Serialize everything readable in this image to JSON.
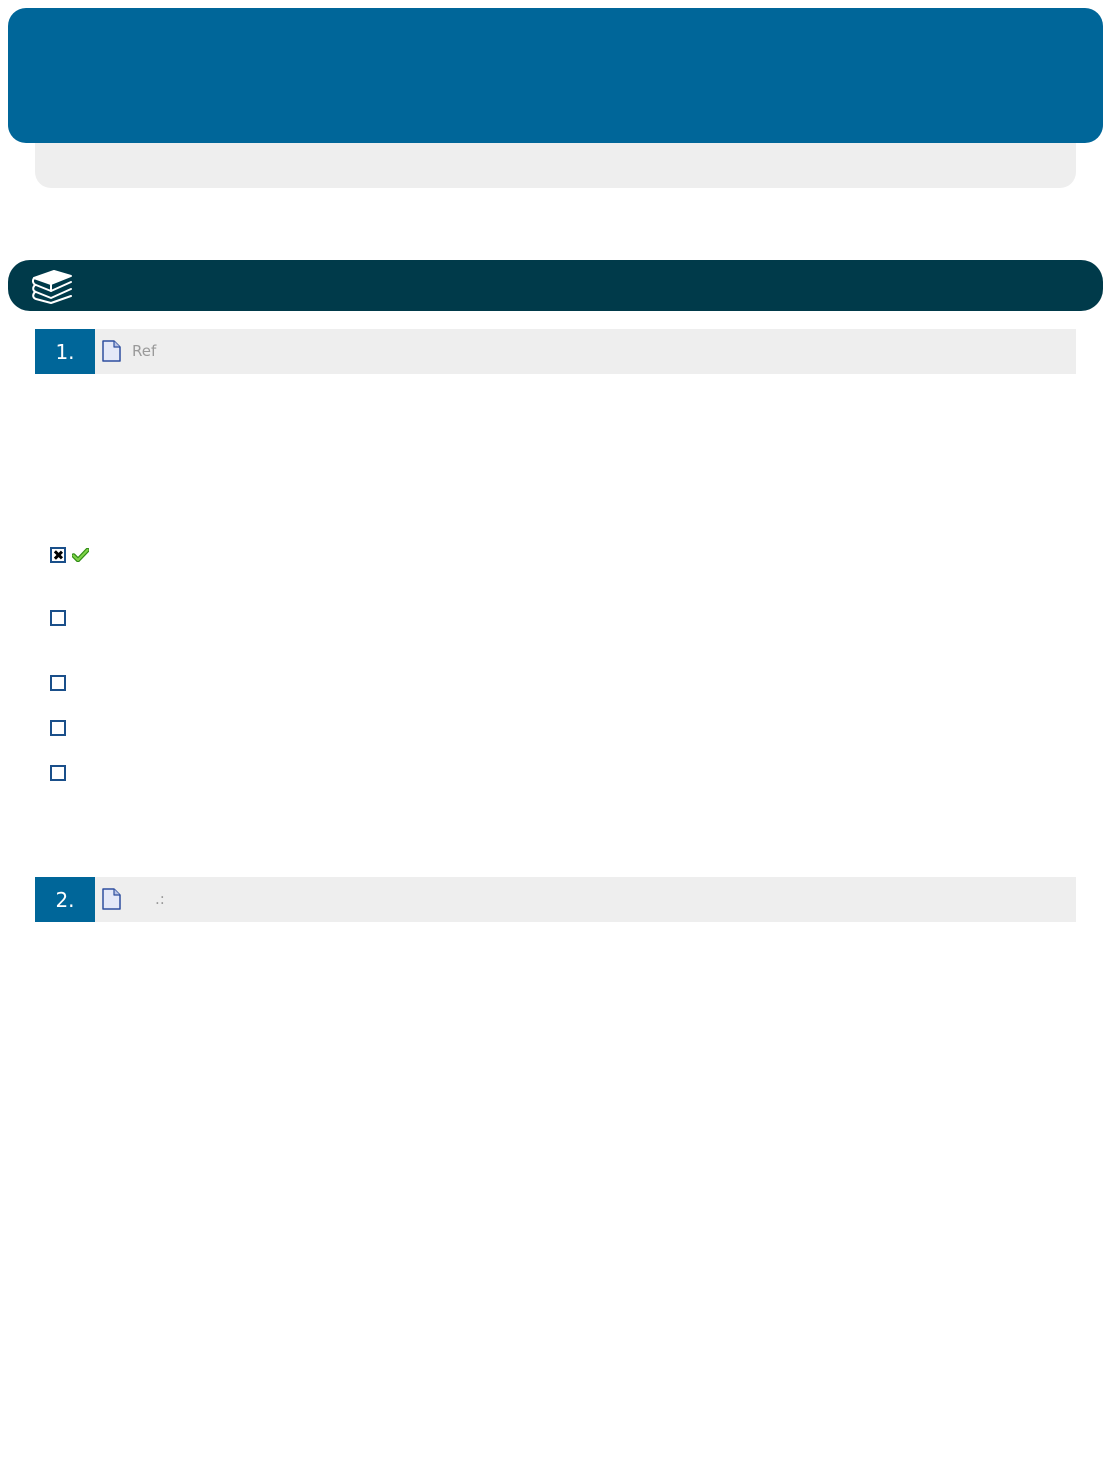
{
  "header": {
    "title": "",
    "subtitle": ""
  },
  "section": {
    "title": "",
    "icon": "books-stack-icon"
  },
  "questions": [
    {
      "number": "1.",
      "text": "Ref",
      "icon": "document-icon",
      "options": [
        {
          "label": "",
          "checked": true,
          "correct": true
        },
        {
          "label": "",
          "checked": false
        },
        {
          "label": "",
          "checked": false
        },
        {
          "label": "",
          "checked": false
        },
        {
          "label": "",
          "checked": false
        }
      ]
    },
    {
      "number": "2.",
      "text": ".:",
      "icon": "document-icon",
      "options": []
    }
  ],
  "colors": {
    "header": "#006699",
    "section_bar": "#003a4a",
    "row_background": "#eeeeee",
    "checkbox_border": "#1a4f8a",
    "correct_mark": "#4cb82a"
  }
}
